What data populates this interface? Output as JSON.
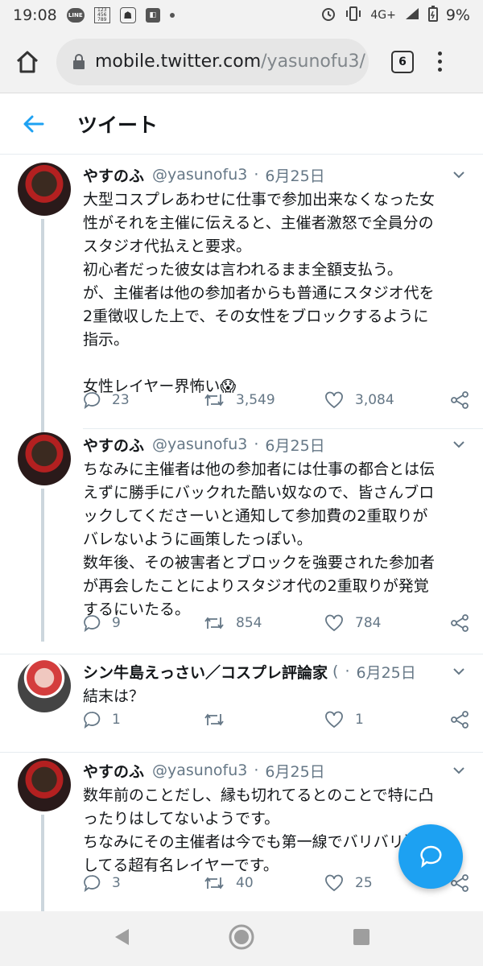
{
  "status_bar": {
    "time": "19:08",
    "line_label": "LINE",
    "grid_rows": [
      "123",
      "456",
      "789"
    ],
    "network": "4G+",
    "battery": "9%"
  },
  "browser": {
    "url_host": "mobile.twitter.com",
    "url_path": "/yasunofu3/",
    "tab_count": "6"
  },
  "header": {
    "title": "ツイート"
  },
  "tweets": [
    {
      "name": "やすのふ",
      "handle": "@yasunofu3",
      "date": "6月25日",
      "lines": [
        "大型コスプレあわせに仕事で参加出来なくなった女",
        "性がそれを主催に伝えると、主催者激怒で全員分の",
        "スタジオ代払えと要求。",
        "初心者だった彼女は言われるまま全額支払う。",
        "が、主催者は他の参加者からも普通にスタジオ代を",
        "2重徴収した上で、その女性をブロックするように",
        "指示。",
        "",
        "女性レイヤー界怖い😱"
      ],
      "replies": "23",
      "retweets": "3,549",
      "likes": "3,084"
    },
    {
      "name": "やすのふ",
      "handle": "@yasunofu3",
      "date": "6月25日",
      "lines": [
        "ちなみに主催者は他の参加者には仕事の都合とは伝",
        "えずに勝手にバックれた酷い奴なので、皆さんブロ",
        "ックしてくださーいと通知して参加費の2重取りが",
        "バレないように画策したっぽい。",
        "数年後、その被害者とブロックを強要された参加者",
        "が再会したことによりスタジオ代の2重取りが発覚",
        "するにいたる。"
      ],
      "replies": "9",
      "retweets": "854",
      "likes": "784"
    },
    {
      "name": "シン牛島えっさい／コスプレ評論家",
      "handle": "(",
      "date": "6月25日",
      "lines": [
        "結末は？"
      ],
      "replies": "1",
      "retweets": "",
      "likes": "1"
    },
    {
      "name": "やすのふ",
      "handle": "@yasunofu3",
      "date": "6月25日",
      "lines": [
        "数年前のことだし、縁も切れてるとのことで特に凸",
        "ったりはしてないようです。",
        "ちなみにその主催者は今でも第一線でバリバリ活動",
        "してる超有名レイヤーです。"
      ],
      "replies": "3",
      "retweets": "40",
      "likes": "25"
    }
  ],
  "colors": {
    "accent": "#1da1f2",
    "secondary_text": "#657786",
    "divider": "#e6ecf0",
    "chrome_bg": "#f2f2f2"
  }
}
